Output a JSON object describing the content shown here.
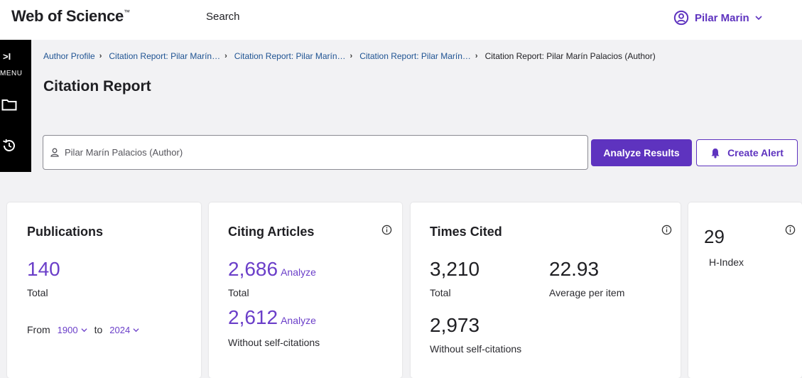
{
  "brand": {
    "name": "Web of Science",
    "tm": "™"
  },
  "nav": {
    "search": "Search"
  },
  "user": {
    "name": "Pilar Marin"
  },
  "rail": {
    "toggle": ">I",
    "menu": "MENU"
  },
  "breadcrumb": {
    "items": [
      "Author Profile",
      "Citation Report: Pilar Marín…",
      "Citation Report: Pilar Marín…",
      "Citation Report: Pilar Marín…"
    ],
    "separator": "›",
    "current": "Citation Report: Pilar Marín Palacios (Author)"
  },
  "page": {
    "title": "Citation Report"
  },
  "query": {
    "text": "Pilar Marín Palacios (Author)"
  },
  "actions": {
    "analyze": "Analyze Results",
    "alert": "Create Alert"
  },
  "cards": {
    "publications": {
      "title": "Publications",
      "total": "140",
      "total_label": "Total",
      "from_label": "From",
      "from_year": "1900",
      "to_label": "to",
      "to_year": "2024"
    },
    "citing": {
      "title": "Citing Articles",
      "total": "2,686",
      "total_label": "Total",
      "analyze_label": "Analyze",
      "without_self": "2,612",
      "without_self_label": "Without self-citations"
    },
    "times_cited": {
      "title": "Times Cited",
      "total": "3,210",
      "total_label": "Total",
      "average": "22.93",
      "average_label": "Average per item",
      "without_self": "2,973",
      "without_self_label": "Without self-citations"
    },
    "h_index": {
      "value": "29",
      "label": "H-Index"
    }
  },
  "colors": {
    "accent": "#5e33bf",
    "link": "#205493",
    "number_purple": "#6b3fc9"
  }
}
